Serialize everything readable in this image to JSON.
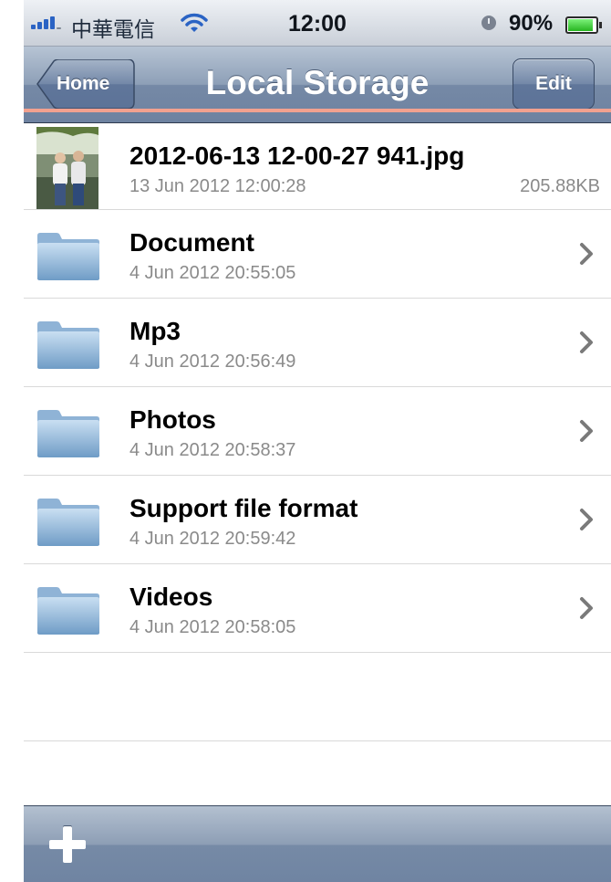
{
  "status_bar": {
    "carrier": "中華電信",
    "time": "12:00",
    "battery_percent": "90%",
    "battery_level": 0.9,
    "icons": [
      "signal-icon",
      "wifi-icon",
      "clock-icon",
      "battery-icon"
    ]
  },
  "nav": {
    "back_label": "Home",
    "title": "Local Storage",
    "edit_label": "Edit"
  },
  "file": {
    "name": "2012-06-13 12-00-27 941.jpg",
    "date": "13 Jun 2012 12:00:28",
    "size": "205.88KB",
    "highlight_color": "#f2a18f"
  },
  "folders": [
    {
      "name": "Document",
      "date": "4 Jun 2012 20:55:05"
    },
    {
      "name": "Mp3",
      "date": "4 Jun 2012 20:56:49"
    },
    {
      "name": "Photos",
      "date": "4 Jun 2012 20:58:37"
    },
    {
      "name": "Support file format",
      "date": "4 Jun 2012 20:59:42"
    },
    {
      "name": "Videos",
      "date": "4 Jun 2012 20:58:05"
    }
  ],
  "toolbar": {
    "add_icon": "plus-icon"
  }
}
